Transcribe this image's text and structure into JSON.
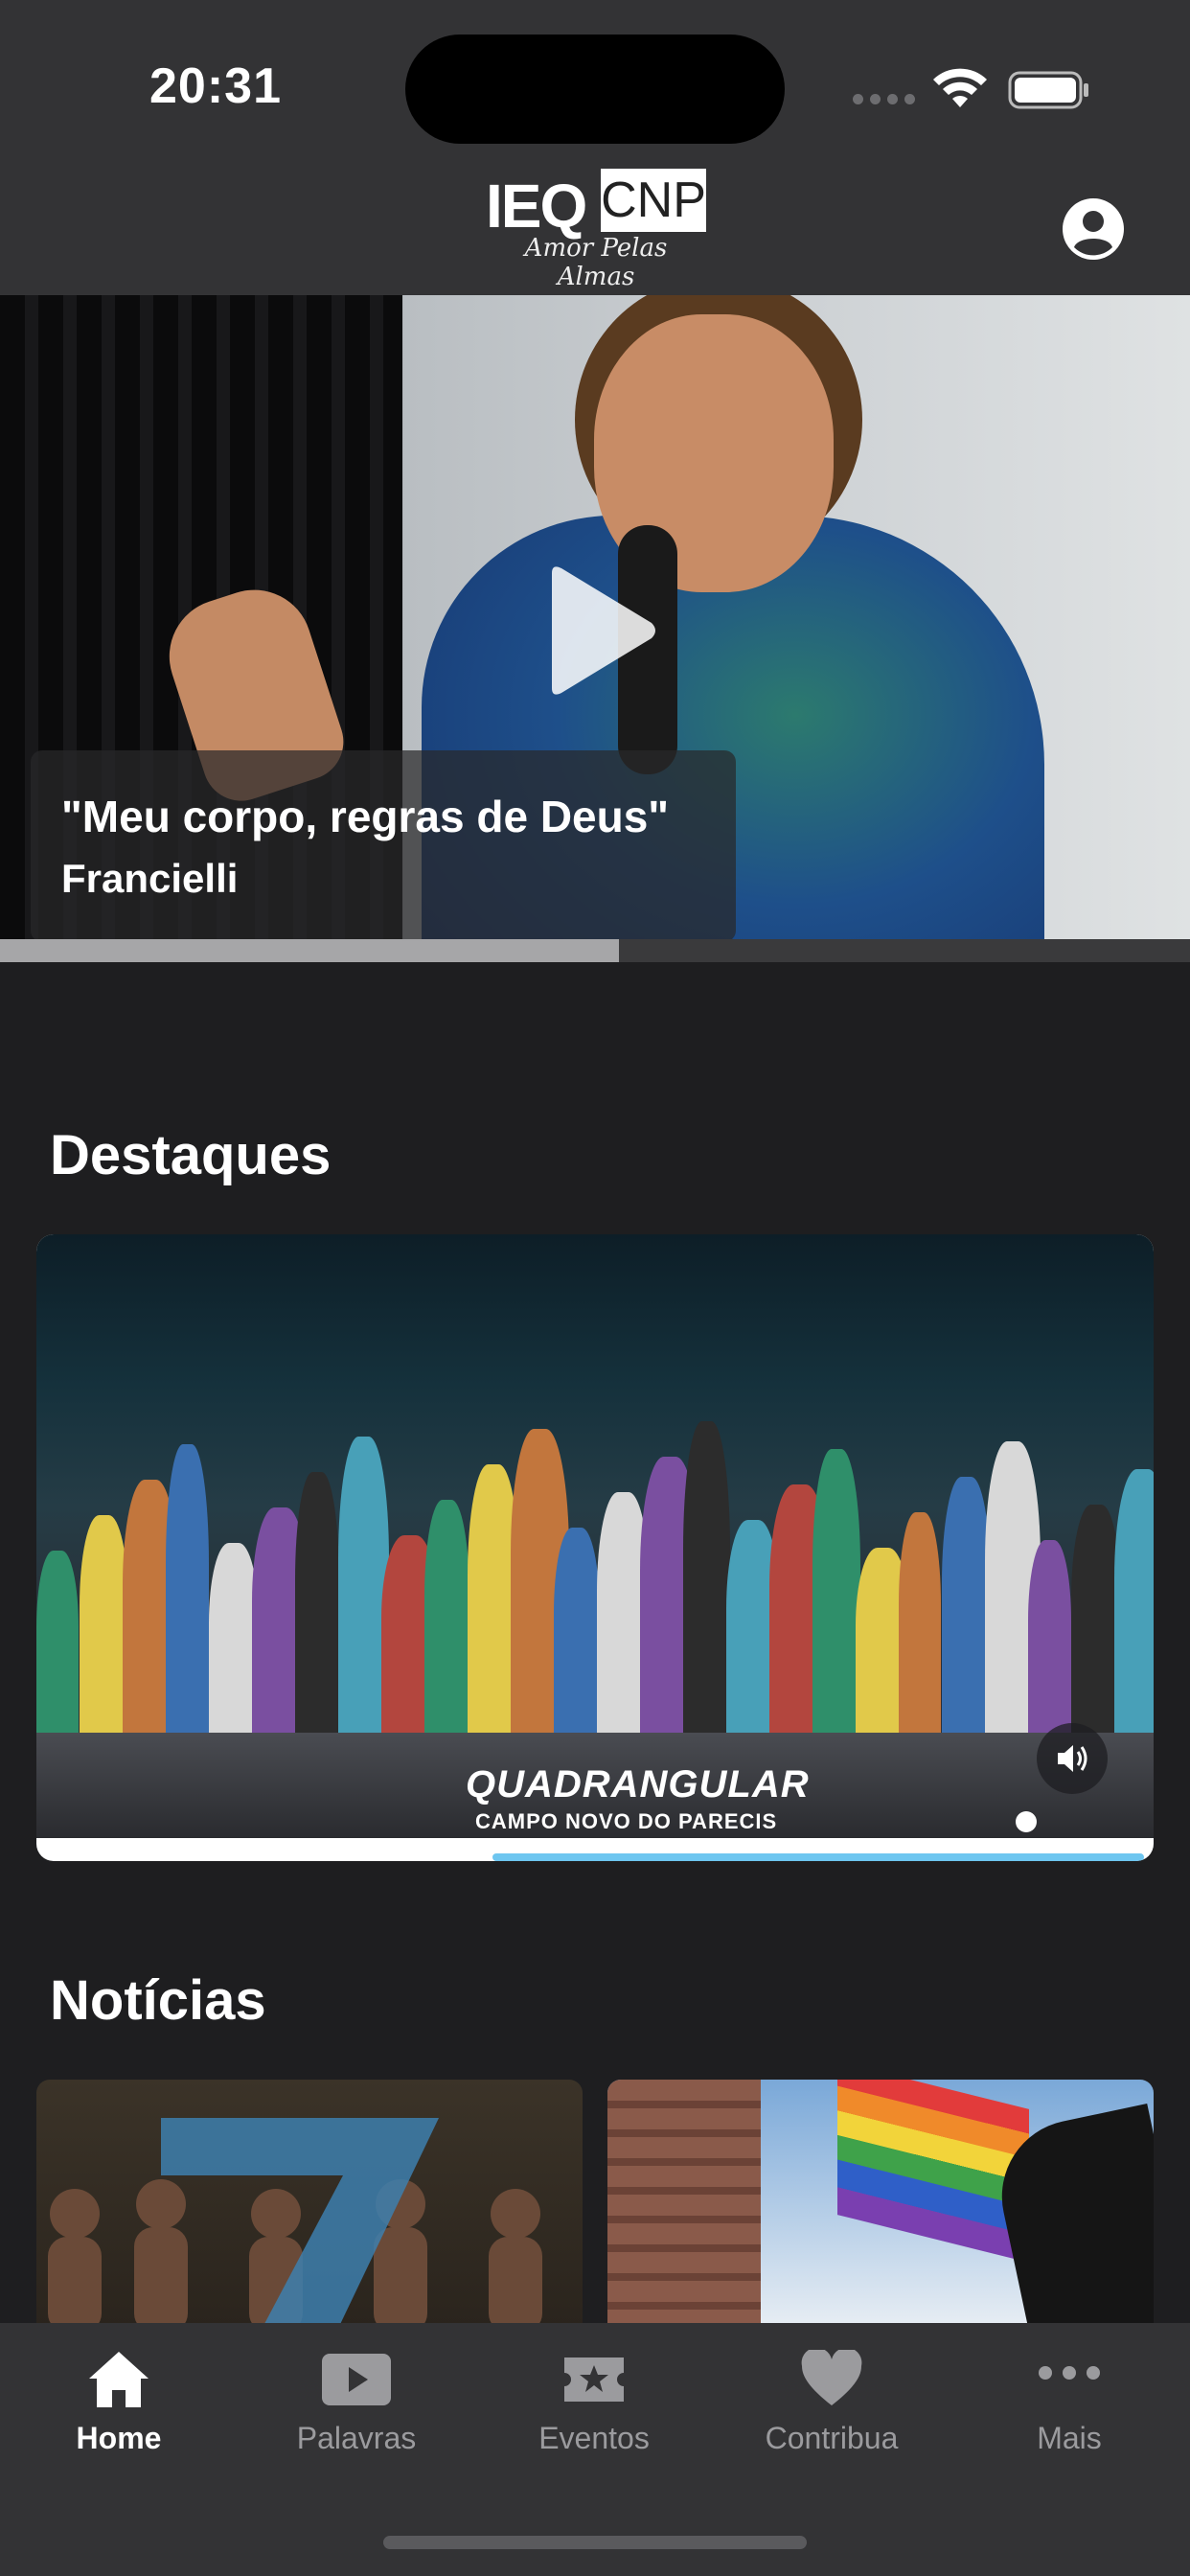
{
  "status_bar": {
    "time": "20:31"
  },
  "header": {
    "logo_primary": "IEQ",
    "logo_secondary": "CNP",
    "logo_tagline": "Amor Pelas Almas",
    "profile_icon": "person-circle-icon"
  },
  "hero": {
    "title": "\"Meu corpo, regras de Deus\"",
    "speaker": "Francielli",
    "play_icon": "play-icon",
    "progress": 0.52
  },
  "sections": {
    "highlights_title": "Destaques",
    "news_title": "Notícias"
  },
  "featured": {
    "watermark_title": "QUADRANGULAR",
    "watermark_subtitle": "CAMPO NOVO DO PARECIS",
    "sound_icon": "speaker-icon"
  },
  "tabs": [
    {
      "label": "Home",
      "icon": "house-icon",
      "active": true
    },
    {
      "label": "Palavras",
      "icon": "play-rectangle-icon",
      "active": false
    },
    {
      "label": "Eventos",
      "icon": "star-ticket-icon",
      "active": false
    },
    {
      "label": "Contribua",
      "icon": "heart-icon",
      "active": false
    },
    {
      "label": "Mais",
      "icon": "ellipsis-icon",
      "active": false
    }
  ],
  "colors": {
    "background": "#1e1e20",
    "bars": "#333335",
    "active_tab": "#ffffff",
    "inactive_tab": "#9b9b9e",
    "accent": "#6ec6f0"
  }
}
